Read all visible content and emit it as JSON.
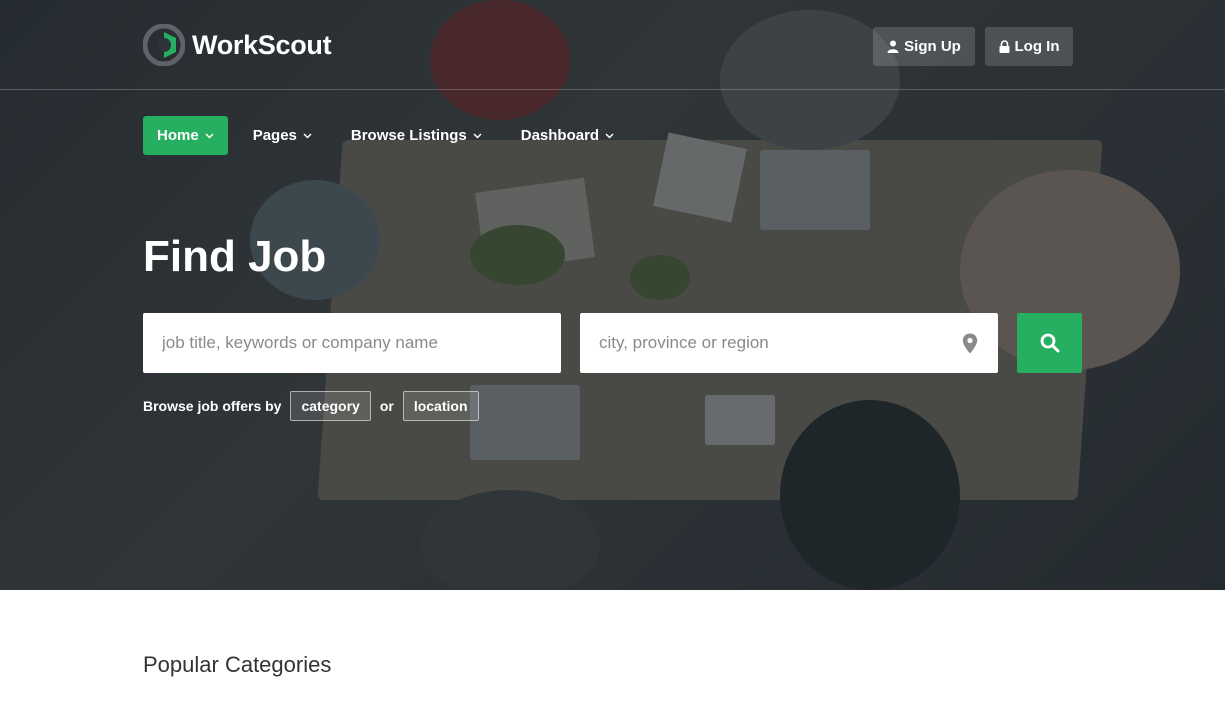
{
  "brand": {
    "name": "WorkScout",
    "accent": "#26ae61"
  },
  "auth": {
    "signup_label": "Sign Up",
    "login_label": "Log In"
  },
  "nav": {
    "items": [
      {
        "label": "Home",
        "active": true
      },
      {
        "label": "Pages",
        "active": false
      },
      {
        "label": "Browse Listings",
        "active": false
      },
      {
        "label": "Dashboard",
        "active": false
      }
    ]
  },
  "hero": {
    "title": "Find Job",
    "keyword_placeholder": "job title, keywords or company name",
    "location_placeholder": "city, province or region",
    "browse_label": "Browse job offers by",
    "browse_category": "category",
    "browse_or": "or",
    "browse_location": "location"
  },
  "sections": {
    "popular_categories": "Popular Categories"
  },
  "icons": [
    "logo-icon",
    "user-icon",
    "lock-icon",
    "chevron-down-icon",
    "map-pin-icon",
    "search-icon"
  ]
}
